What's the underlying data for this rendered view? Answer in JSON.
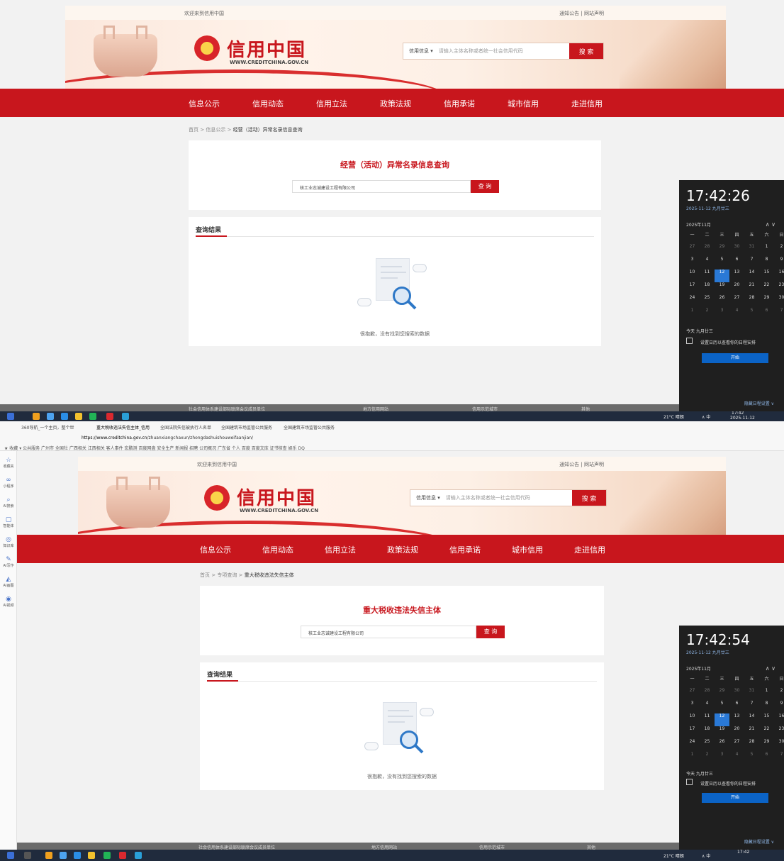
{
  "site": {
    "welcome": "欢迎来到信用中国",
    "notice": "通知公告",
    "sep": "|",
    "statement": "网站声明",
    "logo": "信用中国",
    "logo_sub": "WWW.CREDITCHINA.GOV.CN",
    "search_category": "信用信息 ▾",
    "search_placeholder": "请输入主体名称或者统一社会信用代码",
    "search_button": "搜 索"
  },
  "nav": [
    "信息公示",
    "信用动态",
    "信用立法",
    "政策法规",
    "信用承诺",
    "城市信用",
    "走进信用"
  ],
  "shot1": {
    "breadcrumb_prefix": "首页 > 信息公示 >",
    "breadcrumb_current": "经营（活动）异常名录信息查询",
    "title": "经营（活动）异常名录信息查询",
    "query_value": "核工业志诚建设工程有限公司",
    "query_button": "查 询",
    "results_title": "查询结果",
    "empty_text": "很抱歉，没有找到您搜索的数据"
  },
  "shot2": {
    "breadcrumb_prefix": "首页 > 专项查询 >",
    "breadcrumb_current": "重大税收违法失信主体",
    "title": "重大税收违法失信主体",
    "query_value": "核工业志诚建设工程有限公司",
    "query_button": "查 询",
    "results_title": "查询结果",
    "empty_text": "很抱歉，没有找到您搜索的数据"
  },
  "footer": {
    "a": "社会信用体系建设部际联席会议成员单位",
    "b": "地方信用网站",
    "c": "信用示范城市",
    "d": "其他"
  },
  "clock1": {
    "time": "17:42:26",
    "date": "2025-11-12 九月廿三"
  },
  "clock2": {
    "time": "17:42:54",
    "date": "2025-11-12 九月廿三"
  },
  "calendar": {
    "month": "2025年11月",
    "arrows": "∧ ∨",
    "weekdays": [
      "一",
      "二",
      "三",
      "四",
      "五",
      "六",
      "日"
    ],
    "days": [
      "27",
      "28",
      "29",
      "30",
      "31",
      "1",
      "2",
      "3",
      "4",
      "5",
      "6",
      "7",
      "8",
      "9",
      "10",
      "11",
      "12",
      "13",
      "14",
      "15",
      "16",
      "17",
      "18",
      "19",
      "20",
      "21",
      "22",
      "23",
      "24",
      "25",
      "26",
      "27",
      "28",
      "29",
      "30",
      "1",
      "2",
      "3",
      "4",
      "5",
      "6",
      "7"
    ],
    "today_label": "今天 九月廿三",
    "event_text": "设置日历以查看你的日程安排",
    "start": "开始",
    "hide": "隐藏日程设置 ∨"
  },
  "taskbar": {
    "weather": "21°C 晴朗",
    "tray": "∧ 中",
    "time": "17:42",
    "date": "2025-11-12"
  },
  "browser": {
    "tabs": [
      "360导航_一个主页，整个世",
      "重大税收违法失信主体_信用",
      "全国法院失信被执行人名单",
      "全国建筑市场监管公共服务",
      "全国建筑市场监管公共服务"
    ],
    "url_host": "https://www.creditchina.gov.cn",
    "url_path": "/zhuanxiangchaxun/zhongdashuishouweifaanjian/",
    "bookmarks": "★ 收藏 ▾  公共服务  广州市  全国社  广西相关  江西相关  客人事件  宏鹏测  百度网盘  安全生产  新闻报  招聘  公司概况  广东省  个人  百度  百度文库  证书核查  娱乐  DQ",
    "side": [
      "收藏夹",
      "小程序",
      "AI搜索",
      "智能体",
      "知识库",
      "AI写作",
      "AI画图",
      "AI视频"
    ]
  }
}
